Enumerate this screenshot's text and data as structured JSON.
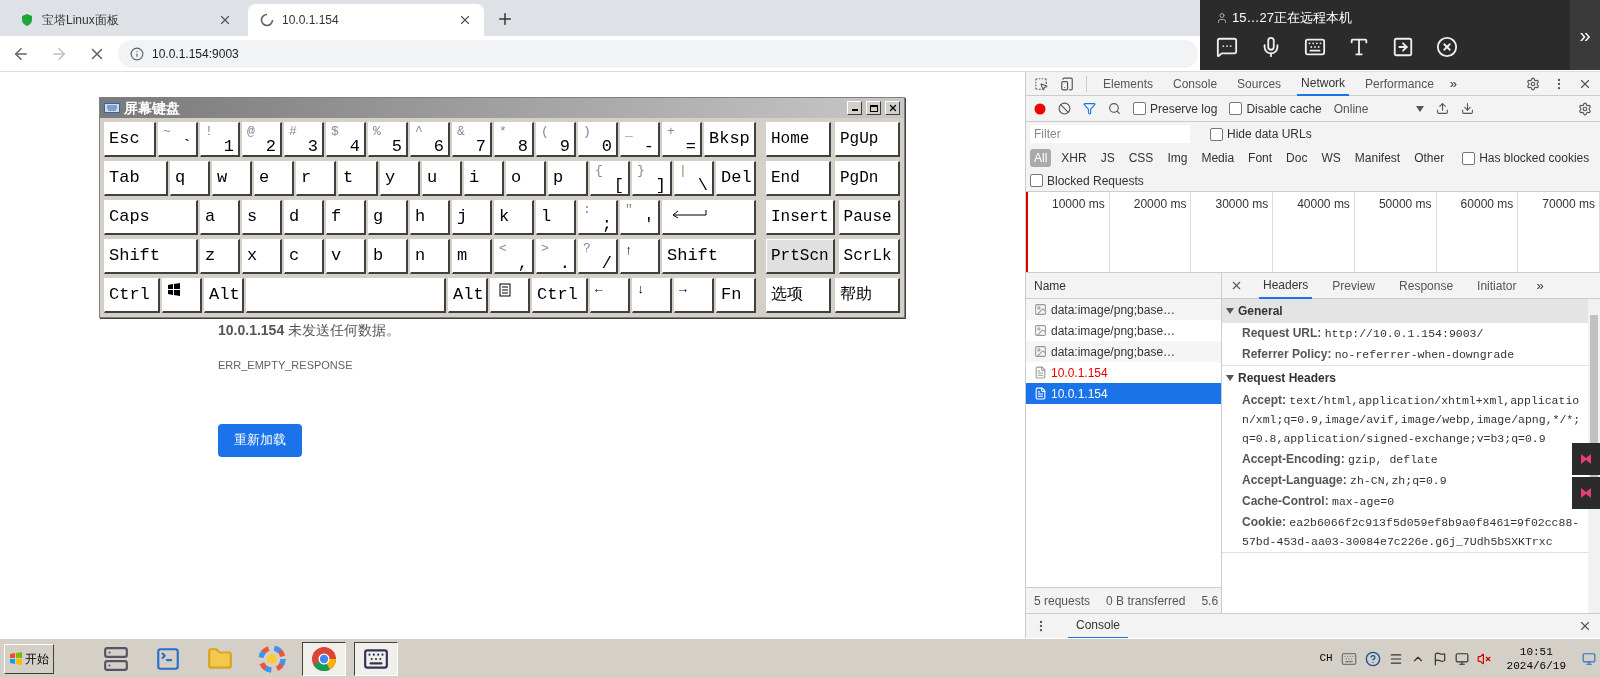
{
  "browser": {
    "tabs": [
      {
        "title": "宝塔Linux面板",
        "selected": false,
        "loading": false
      },
      {
        "title": "10.0.1.154",
        "selected": true,
        "loading": true
      }
    ],
    "address": "10.0.1.154:9003",
    "forward_disabled": true
  },
  "remote_bar": {
    "text": "15…27正在远程本机",
    "more": "»"
  },
  "page": {
    "message": "**10.0.1.154** 未发送任何数据。",
    "error_code": "ERR_EMPTY_RESPONSE",
    "reload_button": "重新加载"
  },
  "keyboard": {
    "title": "屏幕键盘",
    "rows": [
      {
        "keys": [
          {
            "main": "Esc",
            "kind": "wide"
          },
          {
            "top": "~",
            "main": "`",
            "kind": "normal"
          },
          {
            "top": "!",
            "main": "1",
            "kind": "normal"
          },
          {
            "top": "@",
            "main": "2",
            "kind": "normal"
          },
          {
            "top": "#",
            "main": "3",
            "kind": "normal"
          },
          {
            "top": "$",
            "main": "4",
            "kind": "normal"
          },
          {
            "top": "%",
            "main": "5",
            "kind": "normal"
          },
          {
            "top": "^",
            "main": "6",
            "kind": "normal"
          },
          {
            "top": "&",
            "main": "7",
            "kind": "normal"
          },
          {
            "top": "*",
            "main": "8",
            "kind": "normal"
          },
          {
            "top": "(",
            "main": "9",
            "kind": "normal"
          },
          {
            "top": ")",
            "main": "0",
            "kind": "normal"
          },
          {
            "top": "_",
            "main": "-",
            "kind": "normal"
          },
          {
            "top": "+",
            "main": "=",
            "kind": "normal"
          },
          {
            "main": "Bksp",
            "kind": "wide"
          }
        ]
      },
      {
        "keys": [
          {
            "main": "Tab",
            "kind": "wide"
          },
          {
            "main": "q",
            "kind": "normal"
          },
          {
            "main": "w",
            "kind": "normal"
          },
          {
            "main": "e",
            "kind": "normal"
          },
          {
            "main": "r",
            "kind": "normal"
          },
          {
            "main": "t",
            "kind": "normal"
          },
          {
            "main": "y",
            "kind": "normal"
          },
          {
            "main": "u",
            "kind": "normal"
          },
          {
            "main": "i",
            "kind": "normal"
          },
          {
            "main": "o",
            "kind": "normal"
          },
          {
            "main": "p",
            "kind": "normal"
          },
          {
            "top": "{",
            "main": "[",
            "kind": "normal"
          },
          {
            "top": "}",
            "main": "]",
            "kind": "normal"
          },
          {
            "top": "|",
            "main": "\\",
            "kind": "normal"
          },
          {
            "main": "Del",
            "kind": "normal"
          }
        ]
      },
      {
        "keys": [
          {
            "main": "Caps",
            "kind": "wide"
          },
          {
            "main": "a",
            "kind": "normal"
          },
          {
            "main": "s",
            "kind": "normal"
          },
          {
            "main": "d",
            "kind": "normal"
          },
          {
            "main": "f",
            "kind": "normal"
          },
          {
            "main": "g",
            "kind": "normal"
          },
          {
            "main": "h",
            "kind": "normal"
          },
          {
            "main": "j",
            "kind": "normal"
          },
          {
            "main": "k",
            "kind": "normal"
          },
          {
            "main": "l",
            "kind": "normal"
          },
          {
            "top": ":",
            "main": ";",
            "kind": "normal"
          },
          {
            "top": "\"",
            "main": "'",
            "kind": "normal"
          },
          {
            "kind": "enter"
          }
        ]
      },
      {
        "keys": [
          {
            "main": "Shift",
            "kind": "wide"
          },
          {
            "main": "z",
            "kind": "normal"
          },
          {
            "main": "x",
            "kind": "normal"
          },
          {
            "main": "c",
            "kind": "normal"
          },
          {
            "main": "v",
            "kind": "normal"
          },
          {
            "main": "b",
            "kind": "normal"
          },
          {
            "main": "n",
            "kind": "normal"
          },
          {
            "main": "m",
            "kind": "normal"
          },
          {
            "top": "<",
            "main": ",",
            "kind": "normal"
          },
          {
            "top": ">",
            "main": ".",
            "kind": "normal"
          },
          {
            "top": "?",
            "main": "/",
            "kind": "normal"
          },
          {
            "top": "↑",
            "kind": "normal"
          },
          {
            "main": "Shift",
            "kind": "wide"
          }
        ]
      },
      {
        "keys": [
          {
            "main": "Ctrl",
            "kind": "medium"
          },
          {
            "kind": "win"
          },
          {
            "main": "Alt",
            "kind": "normal"
          },
          {
            "kind": "space"
          },
          {
            "main": "Alt",
            "kind": "normal"
          },
          {
            "kind": "menu"
          },
          {
            "main": "Ctrl",
            "kind": "medium"
          },
          {
            "top": "←",
            "kind": "normal"
          },
          {
            "top": "↓",
            "kind": "normal"
          },
          {
            "top": "→",
            "kind": "normal"
          },
          {
            "main": "Fn",
            "kind": "normal"
          }
        ]
      }
    ],
    "side_rows": [
      [
        {
          "label": "Home",
          "highlighted": false
        },
        {
          "label": "PgUp",
          "highlighted": false
        }
      ],
      [
        {
          "label": "End",
          "highlighted": false
        },
        {
          "label": "PgDn",
          "highlighted": false
        }
      ],
      [
        {
          "label": "Insert",
          "highlighted": false
        },
        {
          "label": "Pause",
          "highlighted": false
        }
      ],
      [
        {
          "label": "PrtScn",
          "highlighted": true
        },
        {
          "label": "ScrLk",
          "highlighted": false
        }
      ],
      [
        {
          "label": "选项",
          "highlighted": false
        },
        {
          "label": "帮助",
          "highlighted": false
        }
      ]
    ]
  },
  "devtools": {
    "tabs": [
      {
        "label": "Elements",
        "selected": false
      },
      {
        "label": "Console",
        "selected": false
      },
      {
        "label": "Sources",
        "selected": false
      },
      {
        "label": "Network",
        "selected": true
      },
      {
        "label": "Performance",
        "selected": false
      }
    ],
    "more_tabs": "»",
    "recording": true,
    "preserve_log": {
      "label": "Preserve log",
      "checked": false
    },
    "disable_cache": {
      "label": "Disable cache",
      "checked": false
    },
    "throttling": "Online",
    "filter": {
      "placeholder": "Filter"
    },
    "hide_data_urls": {
      "label": "Hide data URLs",
      "checked": false
    },
    "types": [
      {
        "label": "All",
        "selected": true
      },
      {
        "label": "XHR",
        "selected": false
      },
      {
        "label": "JS",
        "selected": false
      },
      {
        "label": "CSS",
        "selected": false
      },
      {
        "label": "Img",
        "selected": false
      },
      {
        "label": "Media",
        "selected": false
      },
      {
        "label": "Font",
        "selected": false
      },
      {
        "label": "Doc",
        "selected": false
      },
      {
        "label": "WS",
        "selected": false
      },
      {
        "label": "Manifest",
        "selected": false
      },
      {
        "label": "Other",
        "selected": false
      }
    ],
    "has_blocked_cookies": {
      "label": "Has blocked cookies",
      "checked": false
    },
    "blocked_requests": {
      "label": "Blocked Requests",
      "checked": false
    },
    "timeline_ticks": [
      "10000 ms",
      "20000 ms",
      "30000 ms",
      "40000 ms",
      "50000 ms",
      "60000 ms",
      "70000 ms"
    ],
    "requests_header": "Name",
    "requests": [
      {
        "name": "data:image/png;base…",
        "kind": "image",
        "failed": false,
        "selected": false
      },
      {
        "name": "data:image/png;base…",
        "kind": "image",
        "failed": false,
        "selected": false
      },
      {
        "name": "data:image/png;base…",
        "kind": "image",
        "failed": false,
        "selected": false
      },
      {
        "name": "10.0.1.154",
        "kind": "document",
        "failed": true,
        "selected": false
      },
      {
        "name": "10.0.1.154",
        "kind": "document",
        "failed": false,
        "selected": true
      }
    ],
    "summary": [
      "5 requests",
      "0 B transferred",
      "5.6"
    ],
    "detail_tabs": [
      {
        "label": "Headers",
        "selected": true
      },
      {
        "label": "Preview",
        "selected": false
      },
      {
        "label": "Response",
        "selected": false
      },
      {
        "label": "Initiator",
        "selected": false
      }
    ],
    "more_detail_tabs": "»",
    "sections": [
      {
        "title": "General",
        "expanded": true,
        "headers": [
          {
            "name": "Request URL:",
            "value": "http://10.0.1.154:9003/"
          },
          {
            "name": "Referrer Policy:",
            "value": "no-referrer-when-downgrade"
          }
        ]
      },
      {
        "title": "Request Headers",
        "expanded": true,
        "headers": [
          {
            "name": "Accept:",
            "value": "text/html,application/xhtml+xml,application/xml;q=0.9,image/avif,image/webp,image/apng,*/*;q=0.8,application/signed-exchange;v=b3;q=0.9"
          },
          {
            "name": "Accept-Encoding:",
            "value": "gzip, deflate"
          },
          {
            "name": "Accept-Language:",
            "value": "zh-CN,zh;q=0.9"
          },
          {
            "name": "Cache-Control:",
            "value": "max-age=0"
          },
          {
            "name": "Cookie:",
            "value": "ea2b6066f2c913f5d059ef8b9a0f8461=9f02cc88-57bd-453d-aa03-30084e7c226e.g6j_7Udh5bSXKTrxc"
          }
        ]
      }
    ],
    "drawer_tab": "Console"
  },
  "taskbar": {
    "start": "开始",
    "apps": [
      {
        "kind": "server",
        "selected": false
      },
      {
        "kind": "powershell",
        "selected": false
      },
      {
        "kind": "explorer",
        "selected": false
      },
      {
        "kind": "photos",
        "selected": false
      },
      {
        "kind": "chrome",
        "selected": true
      },
      {
        "kind": "keyboard",
        "selected": true
      }
    ],
    "language": "CH",
    "time": "10:51",
    "date": "2024/6/19"
  }
}
